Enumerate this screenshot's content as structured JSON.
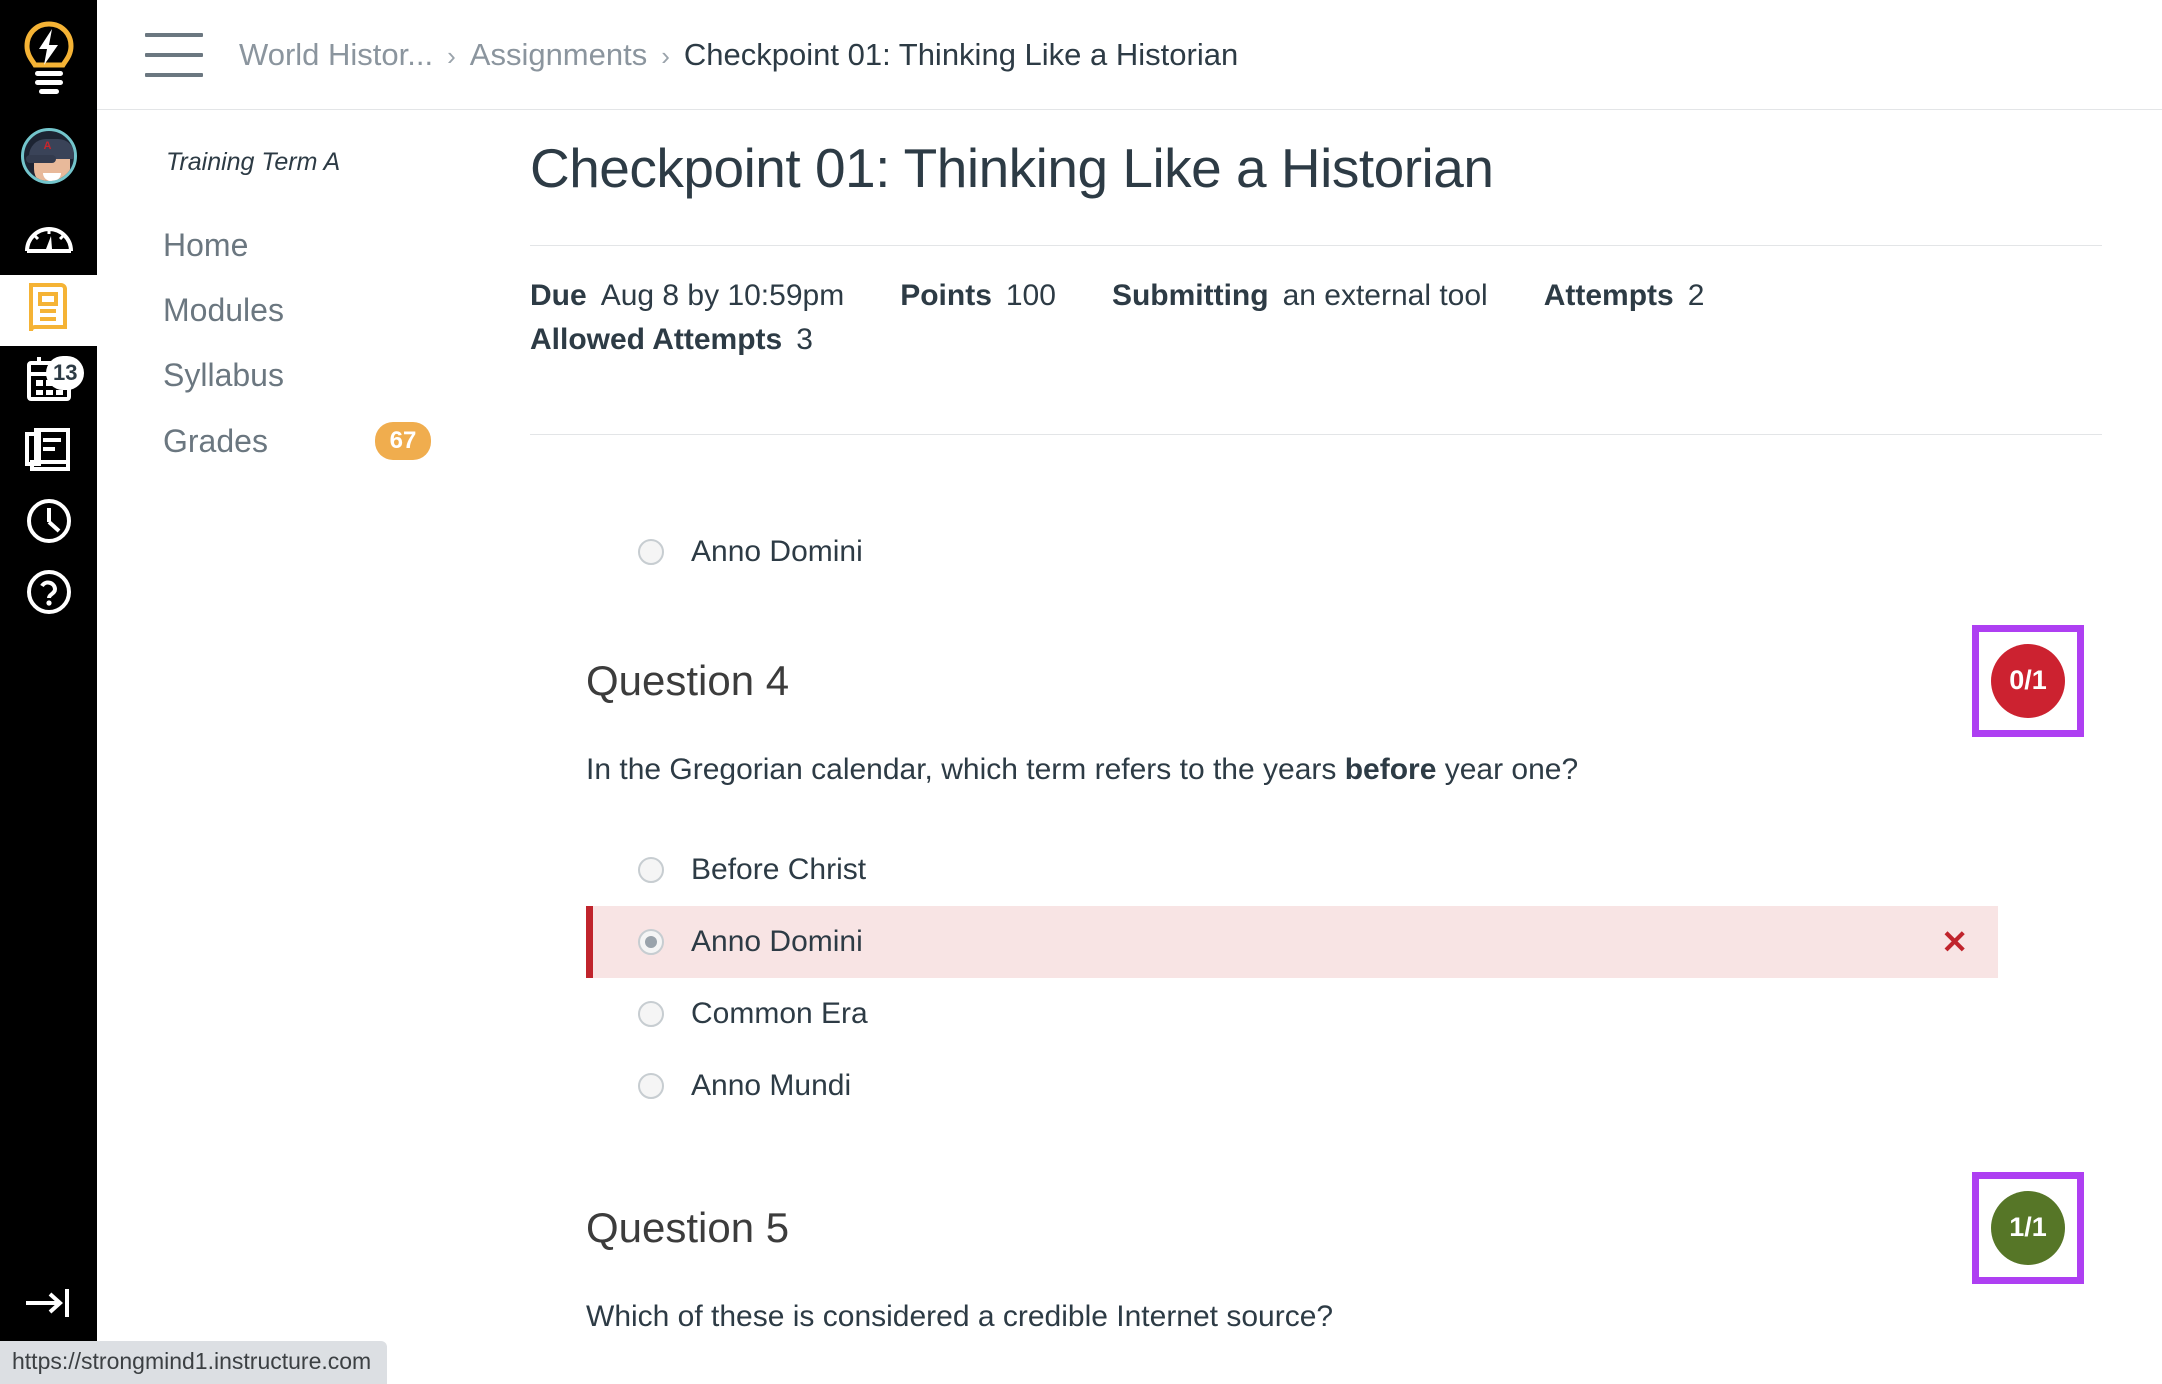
{
  "global_nav": {
    "logo_icon": "lightbulb-logo-icon",
    "avatar_name": "user-avatar",
    "items": [
      {
        "icon": "dashboard-icon",
        "label": "Dashboard",
        "active": false,
        "badge": ""
      },
      {
        "icon": "courses-book-icon",
        "label": "Courses",
        "active": true,
        "badge": ""
      },
      {
        "icon": "calendar-icon",
        "label": "Calendar",
        "active": false,
        "badge": ""
      },
      {
        "icon": "inbox-icon",
        "label": "Inbox",
        "active": false,
        "badge": "13"
      },
      {
        "icon": "history-clock-icon",
        "label": "History",
        "active": false,
        "badge": ""
      },
      {
        "icon": "help-question-icon",
        "label": "Help",
        "active": false,
        "badge": ""
      }
    ],
    "collapse_icon": "arrow-to-bar-expand-icon"
  },
  "header": {
    "menu_icon": "hamburger-menu-icon",
    "breadcrumb": [
      {
        "label": "World Histor...",
        "current": false
      },
      {
        "label": "Assignments",
        "current": false
      },
      {
        "label": "Checkpoint 01: Thinking Like a Historian",
        "current": true
      }
    ],
    "separator": "›"
  },
  "course_nav": {
    "term": "Training Term A",
    "items": [
      {
        "label": "Home",
        "badge": ""
      },
      {
        "label": "Modules",
        "badge": ""
      },
      {
        "label": "Syllabus",
        "badge": ""
      },
      {
        "label": "Grades",
        "badge": "67"
      }
    ]
  },
  "assignment": {
    "title": "Checkpoint 01: Thinking Like a Historian",
    "meta": [
      {
        "label": "Due",
        "value": "Aug 8 by 10:59pm"
      },
      {
        "label": "Points",
        "value": "100"
      },
      {
        "label": "Submitting",
        "value": "an external tool"
      },
      {
        "label": "Attempts",
        "value": "2"
      }
    ],
    "meta_second_row": [
      {
        "label": "Allowed Attempts",
        "value": "3"
      }
    ]
  },
  "partial_answer_above": {
    "label": "Anno Domini",
    "selected": false
  },
  "questions": [
    {
      "title": "Question 4",
      "score": "0/1",
      "score_color": "#cc2230",
      "highlight_color": "#ae3ff2",
      "text_before": "In the Gregorian calendar, which term refers to the years ",
      "text_bold": "before",
      "text_after": " year one?",
      "answers": [
        {
          "label": "Before Christ",
          "selected": false,
          "wrong": false
        },
        {
          "label": "Anno Domini",
          "selected": true,
          "wrong": true,
          "mark": "✕"
        },
        {
          "label": "Common Era",
          "selected": false,
          "wrong": false
        },
        {
          "label": "Anno Mundi",
          "selected": false,
          "wrong": false
        }
      ]
    },
    {
      "title": "Question 5",
      "score": "1/1",
      "score_color": "#567627",
      "highlight_color": "#ae3ff2",
      "text_before": "Which of these is considered a credible Internet source?",
      "text_bold": "",
      "text_after": "",
      "answers": []
    }
  ],
  "status_bar": {
    "url": "https://strongmind1.instructure.com"
  },
  "colors": {
    "rail_bg": "#000000",
    "accent_amber": "#f0ad4e",
    "wrong_bg": "#f8e4e4",
    "wrong_border": "#c0242c",
    "highlight_purple": "#ae3ff2",
    "score_red": "#cc2230",
    "score_green": "#567627",
    "avatar_ring": "#73c5cc"
  }
}
